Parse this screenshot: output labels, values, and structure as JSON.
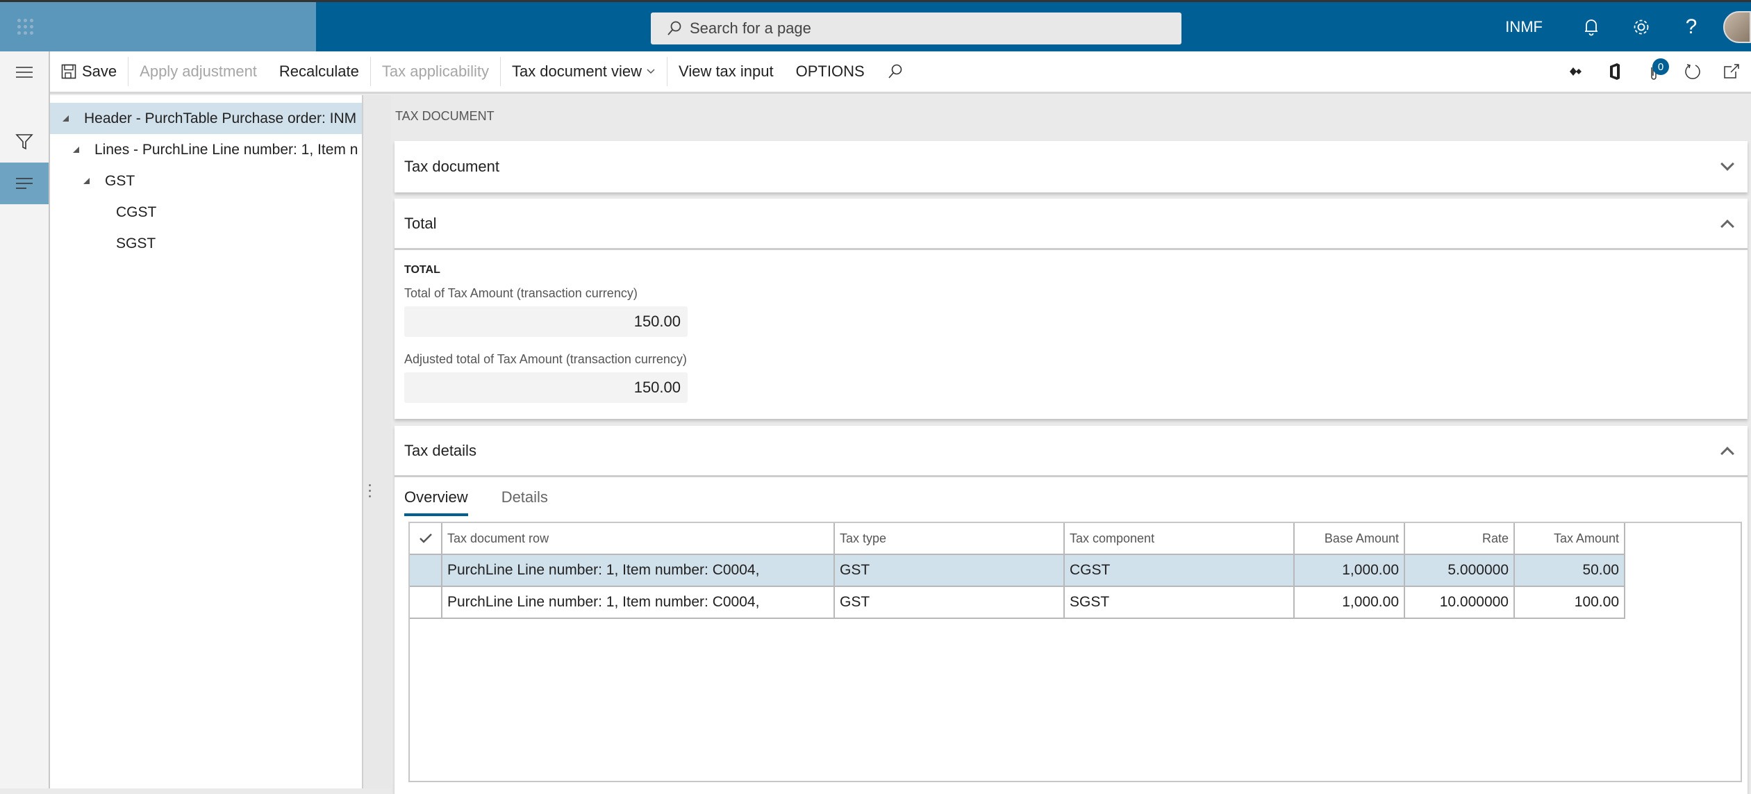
{
  "topbar": {
    "search_placeholder": "Search for a page",
    "company": "INMF",
    "icons": [
      "waffle-icon",
      "bell-icon",
      "gear-icon",
      "help-icon",
      "avatar"
    ]
  },
  "toolbar": {
    "save": "Save",
    "apply_adjustment": "Apply adjustment",
    "recalculate": "Recalculate",
    "tax_applicability": "Tax applicability",
    "tax_document_view": "Tax document view",
    "view_tax_input": "View tax input",
    "options": "OPTIONS",
    "attachments_count": "0"
  },
  "tree": {
    "items": [
      {
        "label": "Header - PurchTable Purchase order: INM",
        "level": 0,
        "expanded": true,
        "selected": true
      },
      {
        "label": "Lines - PurchLine Line number: 1, Item n",
        "level": 1,
        "expanded": true,
        "selected": false
      },
      {
        "label": "GST",
        "level": 2,
        "expanded": true,
        "selected": false
      },
      {
        "label": "CGST",
        "level": 3,
        "expanded": false,
        "selected": false
      },
      {
        "label": "SGST",
        "level": 3,
        "expanded": false,
        "selected": false
      }
    ]
  },
  "content": {
    "caption": "TAX DOCUMENT",
    "sections": {
      "tax_document": {
        "title": "Tax document",
        "expanded": false
      },
      "total": {
        "title": "Total",
        "expanded": true,
        "group_label": "TOTAL",
        "fields": [
          {
            "label": "Total of Tax Amount (transaction currency)",
            "value": "150.00"
          },
          {
            "label": "Adjusted total of Tax Amount (transaction currency)",
            "value": "150.00"
          }
        ]
      },
      "tax_details": {
        "title": "Tax details",
        "expanded": true,
        "tabs": [
          {
            "label": "Overview",
            "active": true
          },
          {
            "label": "Details",
            "active": false
          }
        ],
        "grid": {
          "columns": [
            "Tax document row",
            "Tax type",
            "Tax component",
            "Base Amount",
            "Rate",
            "Tax Amount"
          ],
          "rows": [
            {
              "row": "PurchLine Line number: 1, Item number: C0004,",
              "tax_type": "GST",
              "component": "CGST",
              "base": "1,000.00",
              "rate": "5.000000",
              "amount": "50.00",
              "selected": true
            },
            {
              "row": "PurchLine Line number: 1, Item number: C0004,",
              "tax_type": "GST",
              "component": "SGST",
              "base": "1,000.00",
              "rate": "10.000000",
              "amount": "100.00",
              "selected": false
            }
          ]
        }
      }
    }
  },
  "colors": {
    "brand": "#005f94",
    "brand_light": "#5b97bb",
    "selection": "#d1e1eb"
  }
}
